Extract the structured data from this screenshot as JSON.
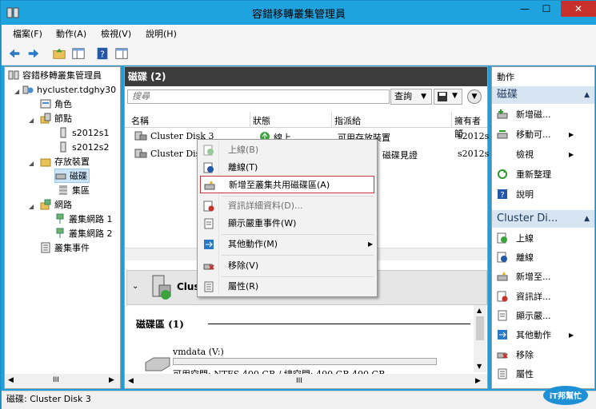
{
  "window": {
    "title": "容錯移轉叢集管理員",
    "min": "—",
    "max": "☐",
    "close": "✕"
  },
  "menu": [
    "檔案(F)",
    "動作(A)",
    "檢視(V)",
    "說明(H)"
  ],
  "tree": {
    "root": "容錯移轉叢集管理員",
    "cluster": "hycluster.tdghy30",
    "roles": "角色",
    "nodes": "節點",
    "node1": "s2012s1",
    "node2": "s2012s2",
    "storage": "存放裝置",
    "disks": "磁碟",
    "pools": "集區",
    "networks": "網路",
    "net1": "叢集網路 1",
    "net2": "叢集網路 2",
    "events": "叢集事件",
    "scroll_mid": "III"
  },
  "center": {
    "header": "磁碟 (2)",
    "search_placeholder": "搜尋",
    "query_label": "查詢",
    "columns": [
      "名稱",
      "狀態",
      "指派給",
      "擁有者節"
    ],
    "rows": [
      {
        "name": "Cluster Disk 3",
        "status": "線上",
        "assigned": "可用存放裝置",
        "owner": "s2012s"
      },
      {
        "name": "Cluster Disk",
        "status": "",
        "assigned": "磁碟見證",
        "owner": "s2012s"
      }
    ],
    "detail_title": "Clus",
    "disks_section": "磁碟區 (1)",
    "volume_name": "vmdata (V:)",
    "volume_info": "可用空間: NTFS 400 GB / 總空間: 400 GB 400 GB",
    "scroll_mid": "III"
  },
  "context_menu": [
    {
      "label": "上線(B)",
      "enabled": false
    },
    {
      "label": "離線(T)",
      "enabled": true
    },
    {
      "label": "新增至叢集共用磁碟區(A)",
      "enabled": true,
      "highlighted": true
    },
    {
      "label": "資訊詳細資料(D)...",
      "enabled": false
    },
    {
      "label": "顯示嚴重事件(W)",
      "enabled": true
    },
    {
      "label": "其他動作(M)",
      "enabled": true,
      "submenu": true
    },
    {
      "label": "移除(V)",
      "enabled": true
    },
    {
      "label": "屬性(R)",
      "enabled": true
    }
  ],
  "actions": {
    "title": "動作",
    "section1": "磁碟",
    "items1": [
      "新增磁...",
      "移動可...",
      "檢視",
      "重新整理",
      "說明"
    ],
    "section2": "Cluster Di...",
    "items2": [
      "上線",
      "離線",
      "新增至...",
      "資訊詳...",
      "顯示嚴...",
      "其他動作",
      "移除",
      "屬性"
    ]
  },
  "status": "磁碟:  Cluster Disk 3",
  "watermark": "iT邦幫忙",
  "colors": {
    "title_bar": "#1fa3de",
    "close": "#c7302b",
    "header": "#3c3c3c",
    "highlight_border": "#c9353b"
  }
}
